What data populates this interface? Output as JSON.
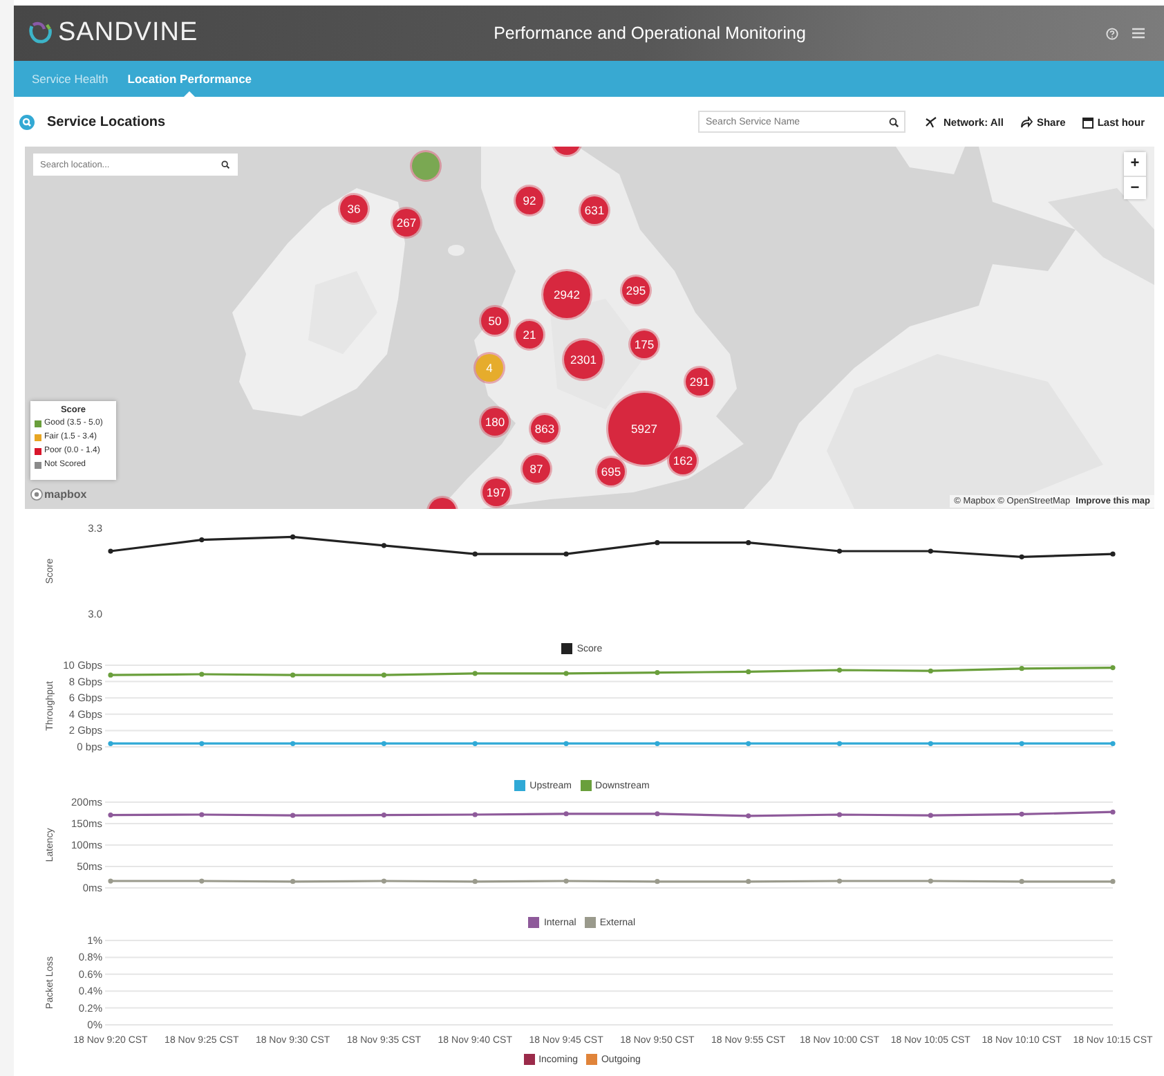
{
  "header": {
    "logo": "SANDVINE",
    "title": "Performance and Operational Monitoring"
  },
  "nav_tabs": [
    {
      "label": "Service Health",
      "selected": false
    },
    {
      "label": "Location Performance",
      "selected": true
    }
  ],
  "toolbar": {
    "title": "Service Locations",
    "search": {
      "placeholder": "Search Service Name"
    },
    "actions": [
      {
        "kind": "network",
        "label": "Network: All"
      },
      {
        "kind": "share",
        "label": "Share"
      },
      {
        "kind": "time",
        "label": "Last hour"
      }
    ]
  },
  "map": {
    "search": {
      "placeholder": "Search location..."
    },
    "zoom_in": "+",
    "zoom_out": "−",
    "markers": [
      {
        "color": "#d7283f"
      },
      {
        "color": "#7aa852"
      },
      {
        "count": "36",
        "color": "#d7283f"
      },
      {
        "count": "267",
        "color": "#d7283f"
      },
      {
        "count": "92",
        "color": "#d7283f"
      },
      {
        "count": "631",
        "color": "#d7283f"
      },
      {
        "count": "2942",
        "color": "#d7283f"
      },
      {
        "count": "295",
        "color": "#d7283f"
      },
      {
        "count": "50",
        "color": "#d7283f"
      },
      {
        "count": "21",
        "color": "#d7283f"
      },
      {
        "count": "175",
        "color": "#d7283f"
      },
      {
        "count": "4",
        "color": "#e6ac2c"
      },
      {
        "count": "2301",
        "color": "#d7283f"
      },
      {
        "count": "291",
        "color": "#d7283f"
      },
      {
        "count": "180",
        "color": "#d7283f"
      },
      {
        "count": "863",
        "color": "#d7283f"
      },
      {
        "count": "5927",
        "color": "#d7283f"
      },
      {
        "count": "87",
        "color": "#d7283f"
      },
      {
        "count": "695",
        "color": "#d7283f"
      },
      {
        "count": "162",
        "color": "#d7283f"
      },
      {
        "count": "197",
        "color": "#d7283f"
      },
      {
        "color": "#d7283f"
      }
    ],
    "legend": {
      "title": "Score",
      "items": [
        {
          "label": "Good (3.5 - 5.0)",
          "color": "#6a9f3c"
        },
        {
          "label": "Fair (1.5 - 3.4)",
          "color": "#e8a623"
        },
        {
          "label": "Poor (0.0 - 1.4)",
          "color": "#d9162b"
        },
        {
          "label": "Not Scored",
          "color": "#8a8a8a"
        }
      ]
    },
    "logo": "mapbox",
    "attribution": "© Mapbox © OpenStreetMap",
    "improve_link": "Improve this map"
  },
  "charts": [
    {
      "chart_data": {
        "type": "line",
        "legend": true,
        "ylabel": "Score",
        "ylim": [
          3.0,
          3.3
        ],
        "yticks": [
          {
            "value": 3.0,
            "label": "3.0"
          },
          {
            "value": 3.3,
            "label": "3.3"
          }
        ],
        "series": [
          {
            "name": "Score",
            "color": "#222222",
            "marker": true,
            "values": [
              3.22,
              3.26,
              3.27,
              3.24,
              3.21,
              3.21,
              3.25,
              3.25,
              3.22,
              3.22,
              3.2,
              3.21
            ]
          }
        ]
      }
    },
    {
      "chart_data": {
        "type": "line",
        "grid": true,
        "legend": true,
        "ylabel": "Throughput",
        "ylim": [
          0,
          10
        ],
        "yticks": [
          {
            "value": 0,
            "label": "0 bps"
          },
          {
            "value": 2,
            "label": "2 Gbps"
          },
          {
            "value": 4,
            "label": "4 Gbps"
          },
          {
            "value": 6,
            "label": "6 Gbps"
          },
          {
            "value": 8,
            "label": "8 Gbps"
          },
          {
            "value": 10,
            "label": "10 Gbps"
          }
        ],
        "series": [
          {
            "name": "Upstream",
            "color": "#2fa9d6",
            "marker": true,
            "values": [
              0.4,
              0.4,
              0.4,
              0.4,
              0.4,
              0.4,
              0.4,
              0.4,
              0.4,
              0.4,
              0.4,
              0.4
            ]
          },
          {
            "name": "Downstream",
            "color": "#6a9f3c",
            "marker": true,
            "values": [
              8.8,
              8.9,
              8.8,
              8.8,
              9.0,
              9.0,
              9.1,
              9.2,
              9.4,
              9.3,
              9.6,
              9.7
            ]
          }
        ]
      }
    },
    {
      "chart_data": {
        "type": "line",
        "grid": true,
        "legend": true,
        "ylabel": "Latency",
        "ylim": [
          0,
          200
        ],
        "yticks": [
          {
            "value": 0,
            "label": "0ms"
          },
          {
            "value": 50,
            "label": "50ms"
          },
          {
            "value": 100,
            "label": "100ms"
          },
          {
            "value": 150,
            "label": "150ms"
          },
          {
            "value": 200,
            "label": "200ms"
          }
        ],
        "series": [
          {
            "name": "Internal",
            "color": "#8e5a9a",
            "marker": true,
            "values": [
              170,
              171,
              169,
              170,
              171,
              173,
              173,
              168,
              171,
              169,
              172,
              177
            ]
          },
          {
            "name": "External",
            "color": "#9a9a8c",
            "marker": true,
            "values": [
              16,
              16,
              15,
              16,
              15,
              16,
              15,
              15,
              16,
              16,
              15,
              15
            ]
          }
        ]
      }
    },
    {
      "chart_data": {
        "type": "line",
        "grid": true,
        "legend": true,
        "ylabel": "Packet Loss",
        "ylim": [
          0,
          1
        ],
        "yticks": [
          {
            "value": 0,
            "label": "0%"
          },
          {
            "value": 0.2,
            "label": "0.2%"
          },
          {
            "value": 0.4,
            "label": "0.4%"
          },
          {
            "value": 0.6,
            "label": "0.6%"
          },
          {
            "value": 0.8,
            "label": "0.8%"
          },
          {
            "value": 1,
            "label": "1%"
          }
        ],
        "categories": [
          "18 Nov 9:20 CST",
          "18 Nov 9:25 CST",
          "18 Nov 9:30 CST",
          "18 Nov 9:35 CST",
          "18 Nov 9:40 CST",
          "18 Nov 9:45 CST",
          "18 Nov 9:50 CST",
          "18 Nov 9:55 CST",
          "18 Nov 10:00 CST",
          "18 Nov 10:05 CST",
          "18 Nov 10:10 CST",
          "18 Nov 10:15 CST"
        ],
        "series": [
          {
            "name": "Incoming",
            "color": "#9b2b4a",
            "values": [
              null,
              null,
              null,
              null,
              null,
              null,
              null,
              null,
              null,
              null,
              null,
              null
            ]
          },
          {
            "name": "Outgoing",
            "color": "#e0843a",
            "values": [
              null,
              null,
              null,
              null,
              null,
              null,
              null,
              null,
              null,
              null,
              null,
              null
            ]
          }
        ]
      }
    }
  ]
}
